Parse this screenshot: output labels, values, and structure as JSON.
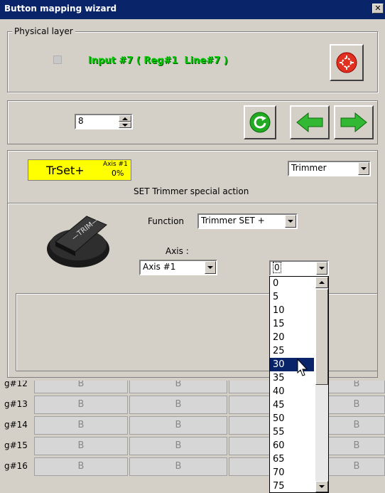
{
  "window": {
    "title": "Button mapping wizard",
    "close": "✕"
  },
  "physical": {
    "group_label": "Physical layer",
    "input_text": "Input #7 ( Reg#1  Line#7 )"
  },
  "nav": {
    "spinner_value": "8"
  },
  "action": {
    "button_label": "TrSet+",
    "axis_badge": "Axis #1",
    "percent_badge": "0%",
    "type_combo": "Trimmer",
    "description": "SET Trimmer special action",
    "function_label": "Function",
    "function_combo": "Trimmer SET +",
    "axis_label": "Axis :",
    "axis_combo": "Axis #1",
    "value_combo": "0"
  },
  "dropdown": {
    "items": [
      "0",
      "5",
      "10",
      "15",
      "20",
      "25",
      "30",
      "35",
      "40",
      "45",
      "50",
      "55",
      "60",
      "65",
      "70",
      "75"
    ],
    "selected_index": 6
  },
  "grid": {
    "rows": [
      {
        "label": "g#12",
        "cells": [
          "B",
          "B",
          "B",
          "B"
        ]
      },
      {
        "label": "g#13",
        "cells": [
          "B",
          "B",
          "B",
          "B"
        ]
      },
      {
        "label": "g#14",
        "cells": [
          "B",
          "B",
          "B",
          "B"
        ]
      },
      {
        "label": "g#15",
        "cells": [
          "B",
          "B",
          "B",
          "B"
        ]
      },
      {
        "label": "g#16",
        "cells": [
          "B",
          "B",
          "B",
          "B"
        ]
      }
    ]
  },
  "colors": {
    "input_text": "#00cc00",
    "action_button_bg": "#ffff00",
    "selection": "#0a246a",
    "titlebar": "#0a246a"
  }
}
